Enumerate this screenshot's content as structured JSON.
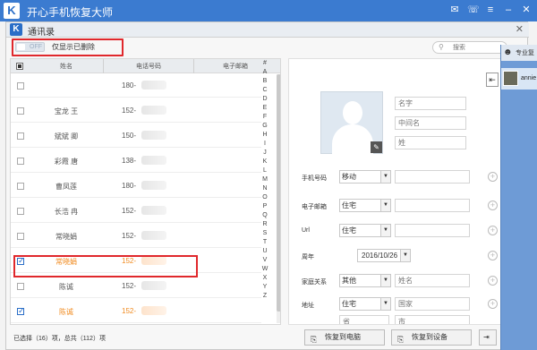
{
  "app": {
    "title": "开心手机恢复大师",
    "logo": "K"
  },
  "dialog": {
    "title": "通讯录",
    "logo": "K"
  },
  "filter": {
    "toggle_text": "OFF",
    "label": "仅显示已删除"
  },
  "search": {
    "placeholder": "搜索"
  },
  "table": {
    "headers": {
      "name": "姓名",
      "phone": "电话号码",
      "email": "电子邮箱"
    },
    "rows": [
      {
        "name": "",
        "phone": "180-",
        "checked": false,
        "deleted": false
      },
      {
        "name": "宝龙 王",
        "phone": "152-",
        "checked": false,
        "deleted": false
      },
      {
        "name": "斌斌 卿",
        "phone": "150-",
        "checked": false,
        "deleted": false
      },
      {
        "name": "彩霞 唐",
        "phone": "138-",
        "checked": false,
        "deleted": false
      },
      {
        "name": "曹凤莲",
        "phone": "180-",
        "checked": false,
        "deleted": false
      },
      {
        "name": "长浩 冉",
        "phone": "152-",
        "checked": false,
        "deleted": false
      },
      {
        "name": "常晓娟",
        "phone": "152-",
        "checked": false,
        "deleted": false
      },
      {
        "name": "常晓娟",
        "phone": "152-",
        "checked": true,
        "deleted": true
      },
      {
        "name": "陈诚",
        "phone": "152-",
        "checked": false,
        "deleted": false
      },
      {
        "name": "陈诚",
        "phone": "152-",
        "checked": true,
        "deleted": true
      }
    ],
    "alphabet": [
      "#",
      "A",
      "B",
      "C",
      "D",
      "E",
      "F",
      "G",
      "H",
      "I",
      "J",
      "K",
      "L",
      "M",
      "N",
      "O",
      "P",
      "Q",
      "R",
      "S",
      "T",
      "U",
      "V",
      "W",
      "X",
      "Y",
      "Z"
    ]
  },
  "detail": {
    "placeholders": {
      "first_name": "名字",
      "middle_name": "中间名",
      "last_name": "姓"
    },
    "fields": {
      "phone": {
        "label": "手机号码",
        "type": "移动"
      },
      "email": {
        "label": "电子邮箱",
        "type": "住宅"
      },
      "url": {
        "label": "Url",
        "type": "住宅"
      },
      "anniversary": {
        "label": "周年",
        "date": "2016/10/26"
      },
      "relation": {
        "label": "家庭关系",
        "type": "其他",
        "placeholder": "姓名"
      },
      "address": {
        "label": "地址",
        "type": "住宅",
        "country_placeholder": "国家",
        "province_placeholder": "省",
        "city_placeholder": "市"
      }
    }
  },
  "status": {
    "text": "已选择（16）项，总共（112）项"
  },
  "buttons": {
    "restore_pc": "恢复到电脑",
    "restore_device": "恢复到设备"
  },
  "side": {
    "title": "专业复",
    "user": "annie"
  }
}
